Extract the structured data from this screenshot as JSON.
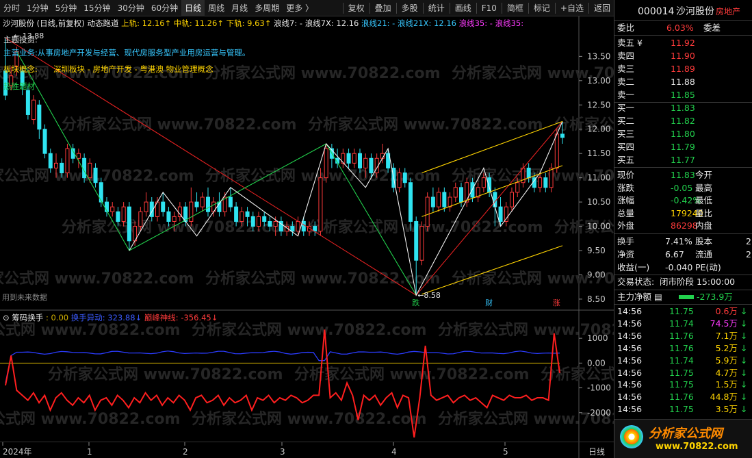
{
  "toolbar": {
    "periods": [
      "分时",
      "1分钟",
      "5分钟",
      "15分钟",
      "30分钟",
      "60分钟",
      "日线",
      "周线",
      "月线",
      "多周期",
      "更多 〉"
    ],
    "active_period": "日线",
    "actions": [
      "复权",
      "叠加",
      "多股",
      "统计",
      "画线",
      "F10",
      "简框",
      "标记",
      "+自选",
      "返回"
    ]
  },
  "stock": {
    "code": "000014",
    "name": "沙河股份",
    "industry": "房地产",
    "chart_title": "沙河股份 (日线,前复权)"
  },
  "main_indicator": {
    "name": "动态跑道",
    "items": [
      {
        "label": "上轨: 12.16",
        "color": "#ffd400"
      },
      {
        "label": "中轨: 11.26",
        "color": "#ffd400"
      },
      {
        "label": "下轨: 9.63",
        "color": "#ffd400"
      },
      {
        "label": "浪线7: -",
        "color": "#e8e8e8"
      },
      {
        "label": "浪线7X: 12.16",
        "color": "#e8e8e8"
      },
      {
        "label": "浪线21: -",
        "color": "#37c8ff"
      },
      {
        "label": "浪线21X: 12.16",
        "color": "#37c8ff"
      },
      {
        "label": "浪线35: -",
        "color": "#ff3bff"
      },
      {
        "label": "浪线35:",
        "color": "#ff3bff"
      }
    ]
  },
  "overlay_text": {
    "high_label": "13.88",
    "tag": "主题投资:",
    "business": "主营业务:从事房地产开发与经营、现代房服务型产业用房运营与管理。",
    "concept_label": "板块概念:",
    "concept_value": "深圳板块 - 房地产开发 - 粤港澳 物业管理概念",
    "theme_label": "热胜题材",
    "future_note": "用到未来数据",
    "low_label": "←8.58",
    "markers": [
      {
        "text": "跌",
        "color": "#22d14d"
      },
      {
        "text": "财",
        "color": "#37c8ff"
      },
      {
        "text": "涨",
        "color": "#ff3b3b"
      }
    ],
    "watermark": "分析家公式网 www.70822.com"
  },
  "sub_indicator": {
    "name": "筹码换手",
    "v1": ": 0.00",
    "v2_label": "换手异动: 323.88",
    "v3_label": "巅峰神线: -356.45"
  },
  "axis": {
    "main_ticks": [
      "13.50",
      "13.00",
      "12.50",
      "12.00",
      "11.50",
      "11.00",
      "10.50",
      "10.00",
      "9.50",
      "9.00",
      "8.50"
    ],
    "sub_ticks": [
      "1000",
      "0.00",
      "-1000",
      "-2000"
    ],
    "x_labels": [
      "2024年",
      "1",
      "2",
      "3",
      "4",
      "5"
    ],
    "period_label": "日线"
  },
  "orderbook": {
    "ratio": {
      "label": "委比",
      "value": "6.03%",
      "label2": "委差"
    },
    "asks": [
      {
        "label": "卖五",
        "price": "11.92",
        "mark": "¥"
      },
      {
        "label": "卖四",
        "price": "11.90"
      },
      {
        "label": "卖三",
        "price": "11.89"
      },
      {
        "label": "卖二",
        "price": "11.88"
      },
      {
        "label": "卖一",
        "price": "11.85"
      }
    ],
    "bids": [
      {
        "label": "买一",
        "price": "11.83"
      },
      {
        "label": "买二",
        "price": "11.82"
      },
      {
        "label": "买三",
        "price": "11.80"
      },
      {
        "label": "买四",
        "price": "11.79"
      },
      {
        "label": "买五",
        "price": "11.77"
      }
    ]
  },
  "quote": [
    {
      "l1": "现价",
      "v1": "11.83",
      "c1": "green",
      "l2": "今开"
    },
    {
      "l1": "涨跌",
      "v1": "-0.05",
      "c1": "green",
      "l2": "最高"
    },
    {
      "l1": "涨幅",
      "v1": "-0.42%",
      "c1": "green",
      "l2": "最低"
    },
    {
      "l1": "总量",
      "v1": "179240",
      "c1": "yellow",
      "l2": "量比"
    },
    {
      "l1": "外盘",
      "v1": "86298",
      "c1": "red",
      "l2": "内盘"
    }
  ],
  "fundamentals": [
    {
      "l1": "换手",
      "v1": "7.41%",
      "l2": "股本",
      "v2": "2"
    },
    {
      "l1": "净资",
      "v1": "6.67",
      "l2": "流通",
      "v2": "2"
    },
    {
      "l1": "收益(一)",
      "v1": "-0.040",
      "l2": "PE(动)",
      "v2": ""
    }
  ],
  "trade_state": {
    "label": "交易状态:",
    "value": "闭市阶段 15:00:00"
  },
  "main_flow": {
    "label": "主力净额",
    "value": "-273.9万"
  },
  "ticks": [
    {
      "time": "14:56",
      "price": "11.75",
      "vol": "0.6万",
      "vc": "red"
    },
    {
      "time": "14:56",
      "price": "11.74",
      "vol": "74.5万",
      "vc": "magenta"
    },
    {
      "time": "14:56",
      "price": "11.76",
      "vol": "7.1万",
      "vc": "yellow"
    },
    {
      "time": "14:56",
      "price": "11.76",
      "vol": "5.2万",
      "vc": "yellow"
    },
    {
      "time": "14:56",
      "price": "11.74",
      "vol": "5.9万",
      "vc": "yellow"
    },
    {
      "time": "14:56",
      "price": "11.75",
      "vol": "4.7万",
      "vc": "yellow"
    },
    {
      "time": "14:56",
      "price": "11.75",
      "vol": "1.5万",
      "vc": "yellow"
    },
    {
      "time": "14:56",
      "price": "11.76",
      "vol": "44.8万",
      "vc": "yellow"
    },
    {
      "time": "14:56",
      "price": "11.75",
      "vol": "3.5万",
      "vc": "yellow"
    }
  ],
  "logo": {
    "text": "分析家公式网",
    "url": "www.70822.com"
  },
  "chart_data": {
    "type": "candlestick",
    "ylim": [
      8.4,
      13.9
    ],
    "candles": [
      [
        13.2,
        12.7,
        13.88,
        12.6
      ],
      [
        12.9,
        13.1,
        13.3,
        12.8
      ],
      [
        13.3,
        13.6,
        13.7,
        13.1
      ],
      [
        13.2,
        12.9,
        13.3,
        12.7
      ],
      [
        12.8,
        12.3,
        12.9,
        12.2
      ],
      [
        12.2,
        12.6,
        12.7,
        12.1
      ],
      [
        12.5,
        12.0,
        12.6,
        11.8
      ],
      [
        12.0,
        11.5,
        12.1,
        11.4
      ],
      [
        11.5,
        11.2,
        11.6,
        11.1
      ],
      [
        11.2,
        11.3,
        11.5,
        11.0
      ],
      [
        11.3,
        11.1,
        11.4,
        11.0
      ],
      [
        11.1,
        11.6,
        11.7,
        11.0
      ],
      [
        11.6,
        11.4,
        11.7,
        11.3
      ],
      [
        11.4,
        11.5,
        11.6,
        11.2
      ],
      [
        11.4,
        11.0,
        11.5,
        10.9
      ],
      [
        11.0,
        11.3,
        11.4,
        10.9
      ],
      [
        11.2,
        10.9,
        11.3,
        10.8
      ],
      [
        10.9,
        10.5,
        11.0,
        10.4
      ],
      [
        10.5,
        10.3,
        10.6,
        10.2
      ],
      [
        10.3,
        10.4,
        10.5,
        10.2
      ],
      [
        10.3,
        10.1,
        10.4,
        10.0
      ],
      [
        10.1,
        10.4,
        10.5,
        10.0
      ],
      [
        10.4,
        9.7,
        10.5,
        9.5
      ],
      [
        9.7,
        10.0,
        10.1,
        9.6
      ],
      [
        10.0,
        10.3,
        10.4,
        9.9
      ],
      [
        10.3,
        10.5,
        10.7,
        10.2
      ],
      [
        10.5,
        10.2,
        10.6,
        10.1
      ],
      [
        10.2,
        10.5,
        10.6,
        10.1
      ],
      [
        10.5,
        10.3,
        10.7,
        10.2
      ],
      [
        10.3,
        10.1,
        10.4,
        10.0
      ],
      [
        10.1,
        10.2,
        10.3,
        9.9
      ],
      [
        10.2,
        10.4,
        10.5,
        10.1
      ],
      [
        10.4,
        10.1,
        10.5,
        10.0
      ],
      [
        10.1,
        10.5,
        10.8,
        10.0
      ],
      [
        10.5,
        10.4,
        10.7,
        10.3
      ],
      [
        10.4,
        10.6,
        10.7,
        10.3
      ],
      [
        10.6,
        10.3,
        10.8,
        10.2
      ],
      [
        10.3,
        10.5,
        10.6,
        10.2
      ],
      [
        10.5,
        10.3,
        10.7,
        10.2
      ],
      [
        10.3,
        10.6,
        10.7,
        10.2
      ],
      [
        10.6,
        10.4,
        10.8,
        10.3
      ],
      [
        10.4,
        10.1,
        10.5,
        10.0
      ],
      [
        10.1,
        10.3,
        10.4,
        10.0
      ],
      [
        10.3,
        10.2,
        10.4,
        10.0
      ],
      [
        10.2,
        10.0,
        10.3,
        9.9
      ],
      [
        10.0,
        10.2,
        10.3,
        9.9
      ],
      [
        10.2,
        10.1,
        10.3,
        10.0
      ],
      [
        10.1,
        10.0,
        10.2,
        9.9
      ],
      [
        10.0,
        10.1,
        10.2,
        9.8
      ],
      [
        10.1,
        9.9,
        10.2,
        9.8
      ],
      [
        9.9,
        10.0,
        10.1,
        9.8
      ],
      [
        10.0,
        9.9,
        10.1,
        9.8
      ],
      [
        9.9,
        10.1,
        10.2,
        9.8
      ],
      [
        10.1,
        9.9,
        10.2,
        9.8
      ],
      [
        9.9,
        10.0,
        10.1,
        9.8
      ],
      [
        10.0,
        9.9,
        10.1,
        9.8
      ],
      [
        9.9,
        11.0,
        11.2,
        9.8
      ],
      [
        11.0,
        11.6,
        11.7,
        10.9
      ],
      [
        11.6,
        11.4,
        11.7,
        11.2
      ],
      [
        11.4,
        11.3,
        11.6,
        11.2
      ],
      [
        11.3,
        11.5,
        11.6,
        11.2
      ],
      [
        11.5,
        11.3,
        11.6,
        11.2
      ],
      [
        11.3,
        11.5,
        11.6,
        11.2
      ],
      [
        11.5,
        11.2,
        11.6,
        11.1
      ],
      [
        11.2,
        11.4,
        11.5,
        11.0
      ],
      [
        11.4,
        11.1,
        11.5,
        11.0
      ],
      [
        11.1,
        11.4,
        11.5,
        11.0
      ],
      [
        11.4,
        11.5,
        11.7,
        11.3
      ],
      [
        11.5,
        11.2,
        11.6,
        11.1
      ],
      [
        11.2,
        10.8,
        11.3,
        10.7
      ],
      [
        10.8,
        11.1,
        11.2,
        10.7
      ],
      [
        11.1,
        10.9,
        11.2,
        10.8
      ],
      [
        10.9,
        10.1,
        11.0,
        9.9
      ],
      [
        10.1,
        9.3,
        10.2,
        8.58
      ],
      [
        9.3,
        10.0,
        10.1,
        9.2
      ],
      [
        10.0,
        10.6,
        10.7,
        9.9
      ],
      [
        10.6,
        10.4,
        10.8,
        10.3
      ],
      [
        10.4,
        10.7,
        10.8,
        10.3
      ],
      [
        10.7,
        10.4,
        10.8,
        10.3
      ],
      [
        10.4,
        10.6,
        10.7,
        10.3
      ],
      [
        10.6,
        10.8,
        10.9,
        10.5
      ],
      [
        10.8,
        10.5,
        10.9,
        10.4
      ],
      [
        10.5,
        10.9,
        11.0,
        10.4
      ],
      [
        10.9,
        10.6,
        11.0,
        10.5
      ],
      [
        10.6,
        10.8,
        10.9,
        10.5
      ],
      [
        10.8,
        11.0,
        11.1,
        10.7
      ],
      [
        11.0,
        10.7,
        11.1,
        10.6
      ],
      [
        10.7,
        10.4,
        10.8,
        10.0
      ],
      [
        10.4,
        10.1,
        10.6,
        10.0
      ],
      [
        10.1,
        10.4,
        10.5,
        10.0
      ],
      [
        10.4,
        10.7,
        10.8,
        10.3
      ],
      [
        10.7,
        10.9,
        11.0,
        10.6
      ],
      [
        10.9,
        11.2,
        11.3,
        10.8
      ],
      [
        11.2,
        11.0,
        11.3,
        10.9
      ],
      [
        11.0,
        10.8,
        11.1,
        10.7
      ],
      [
        10.8,
        11.0,
        11.1,
        10.7
      ],
      [
        11.0,
        10.8,
        11.1,
        10.7
      ],
      [
        10.8,
        11.2,
        11.3,
        10.7
      ],
      [
        11.2,
        11.9,
        12.0,
        11.1
      ],
      [
        11.9,
        11.83,
        12.16,
        11.7
      ]
    ],
    "sub": {
      "ylim": [
        -3000,
        1500
      ],
      "ref_level": 0
    }
  }
}
